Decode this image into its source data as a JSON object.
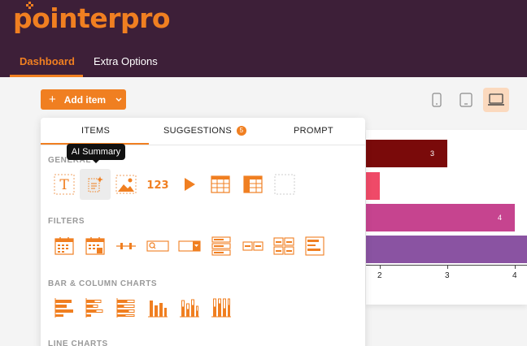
{
  "brand": {
    "logo_text": "pointerpro",
    "accent": "#f07f21",
    "header_bg": "#3d1f38"
  },
  "nav": {
    "tabs": [
      {
        "label": "Dashboard",
        "active": true
      },
      {
        "label": "Extra Options",
        "active": false
      }
    ]
  },
  "toolbar": {
    "add_label": "Add item",
    "add_icon": "plus-icon",
    "chevron_icon": "chevron-down-icon"
  },
  "devices": [
    {
      "name": "mobile-icon",
      "active": false
    },
    {
      "name": "tablet-icon",
      "active": false
    },
    {
      "name": "laptop-icon",
      "active": true
    }
  ],
  "panel": {
    "tabs": [
      {
        "label": "ITEMS",
        "active": true
      },
      {
        "label": "SUGGESTIONS",
        "badge": "5"
      },
      {
        "label": "PROMPT"
      }
    ],
    "tooltip": "AI Summary",
    "sections": [
      {
        "title": "GENERAL",
        "items": [
          "text-icon",
          "ai-summary-icon",
          "image-icon",
          "number-icon",
          "video-icon",
          "table-icon",
          "data-table-icon",
          "empty-placeholder"
        ]
      },
      {
        "title": "FILTERS",
        "items": [
          "date-filter-icon",
          "date-range-filter-icon",
          "range-slider-filter-icon",
          "search-filter-icon",
          "dropdown-filter-icon",
          "list-filter-icon",
          "button-group-filter-icon",
          "grid-filter-icon",
          "form-filter-icon"
        ]
      },
      {
        "title": "BAR & COLUMN CHARTS",
        "items": [
          "bar-chart-icon",
          "stacked-bar-chart-icon",
          "bar-chart-100-icon",
          "column-chart-icon",
          "stacked-column-chart-icon",
          "column-chart-100-icon"
        ]
      },
      {
        "title": "LINE CHARTS",
        "items": []
      }
    ]
  },
  "chart_data": {
    "type": "bar",
    "orientation": "horizontal",
    "values": [
      3,
      2,
      4,
      5
    ],
    "bar_labels": [
      "3",
      "",
      "4",
      ""
    ],
    "colors": [
      "#7a0a0a",
      "#ef4a68",
      "#c6448f",
      "#8a53a2"
    ],
    "x_ticks": [
      "2",
      "3",
      "4"
    ]
  }
}
